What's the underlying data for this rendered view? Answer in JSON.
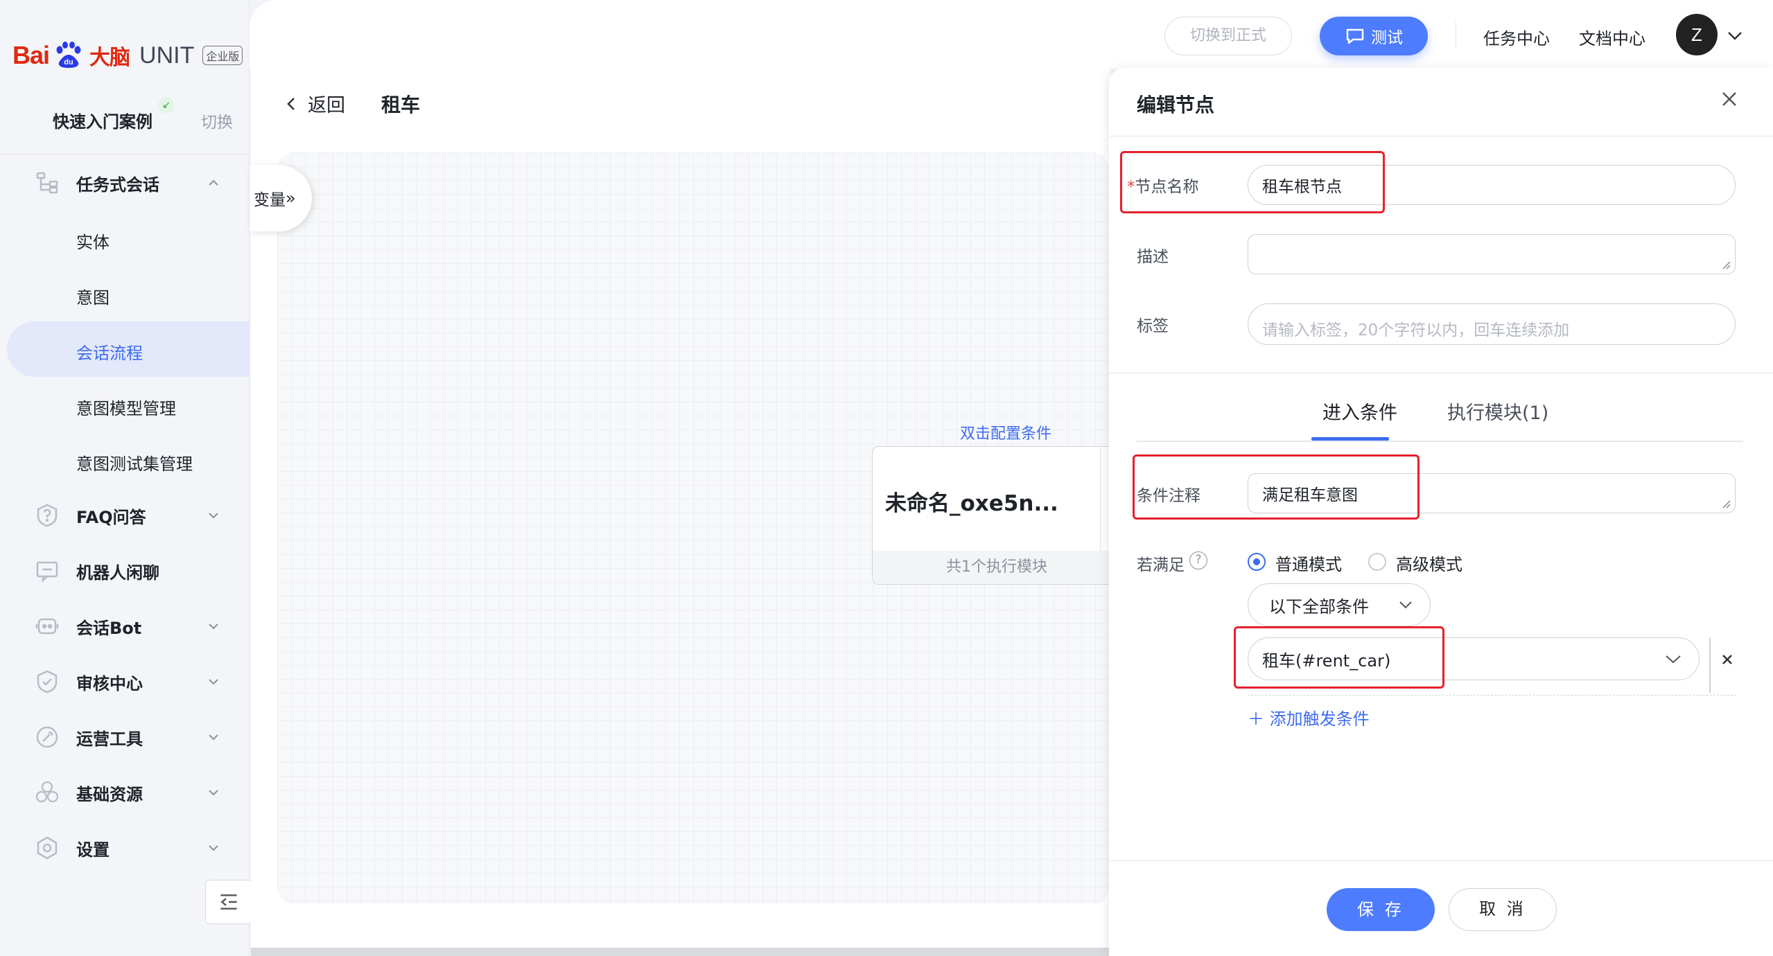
{
  "brand": {
    "logo_text": "Bai",
    "logo_du": "du",
    "logo_cn": "大脑",
    "product": "UNIT",
    "edition": "企业版"
  },
  "project": {
    "name": "快速入门案例",
    "switch_label": "切换"
  },
  "sidebar": {
    "task_dialog": "任务式会话",
    "sub_items": [
      "实体",
      "意图",
      "会话流程",
      "意图模型管理",
      "意图测试集管理"
    ],
    "active_sub": "会话流程",
    "items": [
      {
        "label": "FAQ问答",
        "icon": "question-shield-icon",
        "expandable": true
      },
      {
        "label": "机器人闲聊",
        "icon": "chat-screen-icon",
        "expandable": false
      },
      {
        "label": "会话Bot",
        "icon": "bot-icon",
        "expandable": true
      },
      {
        "label": "审核中心",
        "icon": "shield-check-icon",
        "expandable": true
      },
      {
        "label": "运营工具",
        "icon": "tool-circle-icon",
        "expandable": true
      },
      {
        "label": "基础资源",
        "icon": "hexagons-icon",
        "expandable": true
      },
      {
        "label": "设置",
        "icon": "gear-hex-icon",
        "expandable": true
      }
    ]
  },
  "topbar": {
    "switch_formal": "切换到正式",
    "test": "测试",
    "task_center": "任务中心",
    "doc_center": "文档中心",
    "avatar_letter": "Z"
  },
  "canvas": {
    "back_label": "返回",
    "page_title": "租车",
    "variables_btn": "变量",
    "node": {
      "hint": "双击配置条件",
      "name": "未命名_oxe5n...",
      "footer": "共1个执行模块"
    }
  },
  "panel": {
    "title": "编辑节点",
    "node_name_label": "节点名称",
    "node_name_value": "租车根节点",
    "desc_label": "描述",
    "desc_value": "",
    "tags_label": "标签",
    "tags_placeholder": "请输入标签，20个字符以内，回车连续添加",
    "tabs": [
      "进入条件",
      "执行模块(1)"
    ],
    "active_tab": "进入条件",
    "cond_note_label": "条件注释",
    "cond_note_value": "满足租车意图",
    "if_met_label": "若满足",
    "mode_normal": "普通模式",
    "mode_advanced": "高级模式",
    "selected_mode": "普通模式",
    "match_select": "以下全部条件",
    "condition_value": "租车(#rent_car)",
    "add_trigger": "添加触发条件",
    "save": "保 存",
    "cancel": "取 消"
  },
  "colors": {
    "accent": "#4d7cfe",
    "highlight": "#e5202e",
    "brand_red": "#de2910",
    "link": "#3d6cf0"
  }
}
